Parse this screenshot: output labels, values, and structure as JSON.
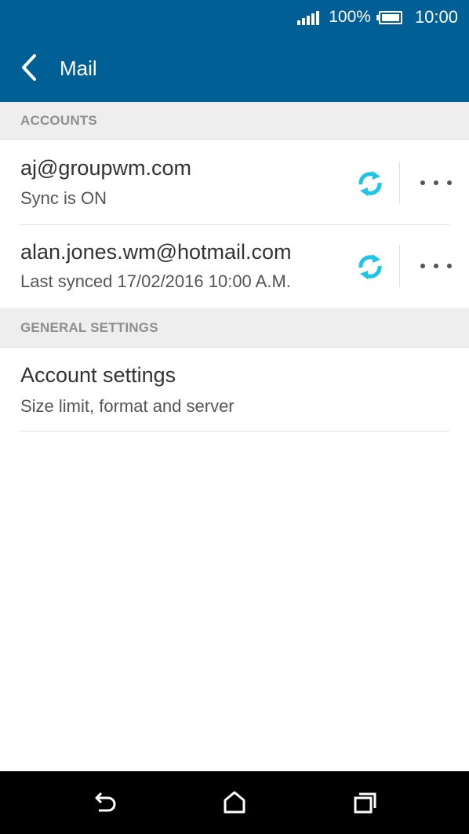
{
  "status_bar": {
    "battery_percent": "100%",
    "time": "10:00"
  },
  "app_bar": {
    "title": "Mail"
  },
  "sections": {
    "accounts_header": "ACCOUNTS",
    "general_header": "GENERAL SETTINGS"
  },
  "accounts": [
    {
      "email": "aj@groupwm.com",
      "status": "Sync is ON"
    },
    {
      "email": "alan.jones.wm@hotmail.com",
      "status": "Last synced 17/02/2016 10:00 A.M."
    }
  ],
  "general": {
    "account_settings_title": "Account settings",
    "account_settings_sub": "Size limit, format and server"
  },
  "colors": {
    "header_blue": "#005f95",
    "sync_cyan": "#1ec6e6"
  }
}
